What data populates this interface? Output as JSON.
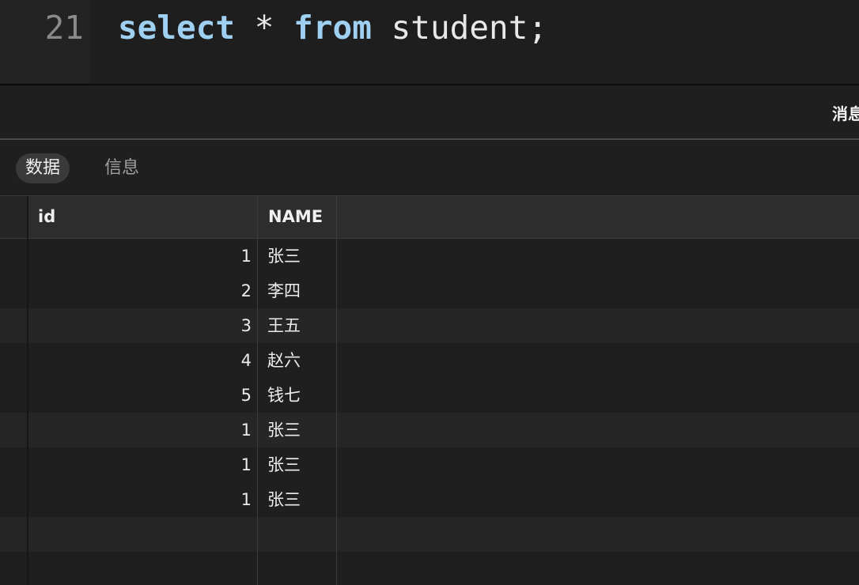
{
  "editor": {
    "line_number": "21",
    "code": {
      "kw_select": "select",
      "star": " * ",
      "kw_from": "from",
      "rest": " student;"
    }
  },
  "message_bar": {
    "label": "消息"
  },
  "result_tabs": {
    "data_label": "数据",
    "info_label": "信息",
    "active": "数据"
  },
  "grid": {
    "columns": [
      "id",
      "NAME"
    ],
    "rows": [
      {
        "id": "1",
        "name": "张三"
      },
      {
        "id": "2",
        "name": "李四"
      },
      {
        "id": "3",
        "name": "王五"
      },
      {
        "id": "4",
        "name": "赵六"
      },
      {
        "id": "5",
        "name": "钱七"
      },
      {
        "id": "1",
        "name": "张三"
      },
      {
        "id": "1",
        "name": "张三"
      },
      {
        "id": "1",
        "name": "张三"
      }
    ]
  },
  "colors": {
    "background": "#1e1e1e",
    "keyword": "#9fd0f2",
    "text": "#e6e6e6"
  }
}
